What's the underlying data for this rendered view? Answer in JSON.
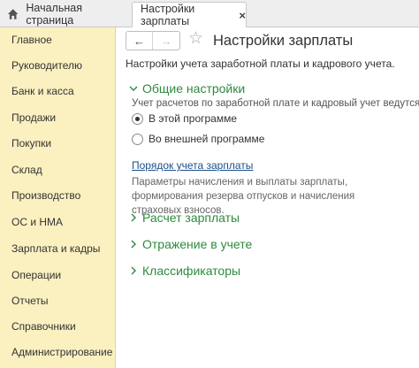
{
  "tabs": {
    "home": {
      "label": "Начальная страница",
      "icon": "home-icon"
    },
    "active": {
      "label": "Настройки зарплаты",
      "close": "×"
    }
  },
  "sidebar": {
    "items": [
      {
        "label": "Главное"
      },
      {
        "label": "Руководителю"
      },
      {
        "label": "Банк и касса"
      },
      {
        "label": "Продажи"
      },
      {
        "label": "Покупки"
      },
      {
        "label": "Склад"
      },
      {
        "label": "Производство"
      },
      {
        "label": "ОС и НМА"
      },
      {
        "label": "Зарплата и кадры"
      },
      {
        "label": "Операции"
      },
      {
        "label": "Отчеты"
      },
      {
        "label": "Справочники"
      },
      {
        "label": "Администрирование"
      }
    ]
  },
  "toolbar": {
    "back_icon": "←",
    "forward_icon": "→",
    "favorite_icon": "☆"
  },
  "page": {
    "title": "Настройки зарплаты",
    "subtitle": "Настройки учета заработной платы и кадрового учета."
  },
  "sections": {
    "general": {
      "title": "Общие настройки",
      "expanded": true,
      "field_label": "Учет расчетов по заработной плате и кадровый учет ведутся:",
      "options": [
        {
          "label": "В этой программе",
          "selected": true
        },
        {
          "label": "Во внешней программе",
          "selected": false
        }
      ],
      "link": "Порядок учета зарплаты",
      "link_description": "Параметры начисления и выплаты зарплаты, формирования резерва отпусков и начисления страховых взносов."
    },
    "collapsed": [
      {
        "title": "Расчет зарплаты"
      },
      {
        "title": "Отражение в учете"
      },
      {
        "title": "Классификаторы"
      }
    ]
  },
  "colors": {
    "sidebar_bg": "#fbf0c0",
    "section_green": "#2e8a3e",
    "link_blue": "#1a4f8b"
  }
}
